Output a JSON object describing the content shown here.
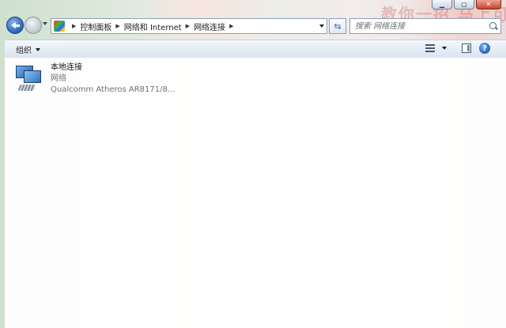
{
  "background": {
    "overlay_text": "教你一招 马上可以"
  },
  "navigation": {
    "breadcrumbs": [
      "控制面板",
      "网络和 Internet",
      "网络连接"
    ],
    "search": {
      "placeholder": "搜索 网络连接"
    }
  },
  "command_bar": {
    "organize_label": "组织"
  },
  "connections": [
    {
      "name": "本地连接",
      "network": "网络",
      "adapter": "Qualcomm Atheros AR8171/8..."
    }
  ],
  "colors": {
    "accent": "#2461b8",
    "command_bar": "#e3ebf5",
    "secondary_text": "#6f6f6f"
  },
  "icons": {
    "back": "back-arrow-icon",
    "forward": "forward-arrow-icon",
    "refresh": "refresh-icon",
    "search": "search-icon",
    "views": "views-icon",
    "preview_pane": "preview-pane-icon",
    "help": "help-icon",
    "connection": "network-connection-icon"
  }
}
